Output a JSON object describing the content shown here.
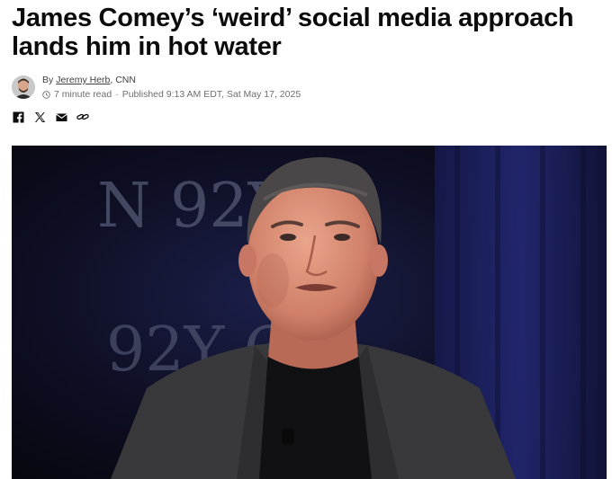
{
  "article": {
    "headline": "James Comey’s ‘weird’ social media approach lands him in hot water",
    "byline_prefix": "By",
    "author": "Jeremy Herb",
    "outlet_suffix": ", CNN",
    "read_time": "7 minute read",
    "separator": "·",
    "published": "Published 9:13 AM EDT, Sat May 17, 2025"
  },
  "share": [
    {
      "icon": "facebook-icon"
    },
    {
      "icon": "x-icon"
    },
    {
      "icon": "email-icon"
    },
    {
      "icon": "link-icon"
    }
  ],
  "photo": {
    "backdrop_text_1": "N 92Y",
    "backdrop_text_2": "92Y Q",
    "accent_colors": {
      "stage_light": "#2a2f8a",
      "suit": "#3a3a3c",
      "skin": "#d98c75"
    }
  }
}
